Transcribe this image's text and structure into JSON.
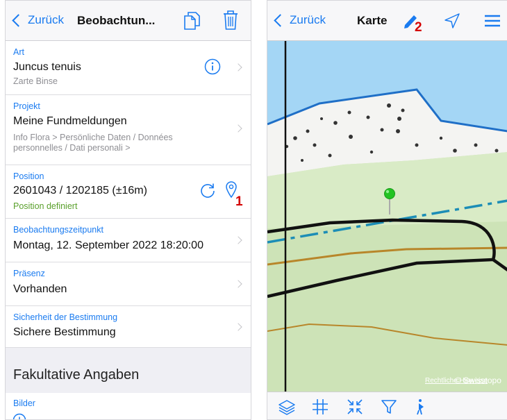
{
  "left_screen": {
    "navbar": {
      "back_label": "Zurück",
      "title": "Beobachtun..."
    },
    "cells": {
      "art": {
        "caption": "Art",
        "value": "Juncus tenuis",
        "subtitle": "Zarte Binse"
      },
      "projekt": {
        "caption": "Projekt",
        "value": "Meine Fundmeldungen",
        "subtitle_line1": "Info Flora > Persönliche Daten / Données",
        "subtitle_line2": "personnelles / Dati personali >"
      },
      "position": {
        "caption": "Position",
        "value": "2601043 / 1202185 (±16m)",
        "status": "Position definiert",
        "marker": "1"
      },
      "zeitpunkt": {
        "caption": "Beobachtungszeitpunkt",
        "value": "Montag, 12. September 2022 18:20:00"
      },
      "praesenz": {
        "caption": "Präsenz",
        "value": "Vorhanden"
      },
      "sicherheit": {
        "caption": "Sicherheit der Bestimmung",
        "value": "Sichere Bestimmung"
      }
    },
    "section_title": "Fakultative Angaben",
    "bilder": {
      "caption": "Bilder"
    }
  },
  "right_screen": {
    "navbar": {
      "back_label": "Zurück",
      "title": "Karte",
      "marker": "2"
    },
    "map_attribution": {
      "legal": "Rechtliche Hinweise",
      "source": "© Swisstopo"
    }
  },
  "colors": {
    "accent": "#1a7bf0",
    "status_green": "#5aa02c",
    "marker_red": "#d40000"
  },
  "icons": [
    "chevron-left-icon",
    "copy-icon",
    "trash-icon",
    "info-icon",
    "chevron-right-icon",
    "refresh-icon",
    "map-pin-icon",
    "plus-circle-icon",
    "pencil-icon",
    "location-arrow-icon",
    "menu-icon",
    "layers-icon",
    "grid-icon",
    "compress-icon",
    "filter-icon",
    "walk-icon"
  ]
}
